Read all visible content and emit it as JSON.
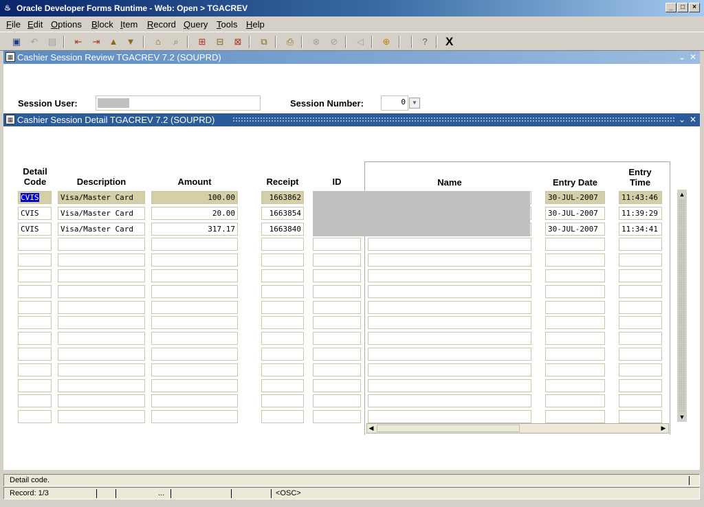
{
  "window": {
    "title": "Oracle Developer Forms Runtime - Web:  Open > TGACREV"
  },
  "menu": [
    {
      "label": "File",
      "u": "F",
      "rest": "ile"
    },
    {
      "label": "Edit",
      "u": "E",
      "rest": "dit"
    },
    {
      "label": "Options",
      "u": "O",
      "rest": "ptions"
    },
    {
      "label": "Block",
      "u": "B",
      "rest": "lock"
    },
    {
      "label": "Item",
      "u": "I",
      "rest": "tem"
    },
    {
      "label": "Record",
      "u": "R",
      "rest": "ecord"
    },
    {
      "label": "Query",
      "u": "Q",
      "rest": "uery"
    },
    {
      "label": "Tools",
      "u": "T",
      "rest": "ools"
    },
    {
      "label": "Help",
      "u": "H",
      "rest": "elp"
    }
  ],
  "toolbar": {
    "exit_label": "X"
  },
  "review_panel": {
    "title": "Cashier Session Review  TGACREV  7.2  (SOUPRD)",
    "session_user_label": "Session User:",
    "session_user_value": "",
    "session_number_label": "Session Number:",
    "session_number_value": "0"
  },
  "detail_panel": {
    "title": "Cashier Session Detail  TGACREV  7.2  (SOUPRD)",
    "headers": {
      "detail_code_1": "Detail",
      "detail_code_2": "Code",
      "description": "Description",
      "amount": "Amount",
      "receipt": "Receipt",
      "id": "ID",
      "name": "Name",
      "entry_date": "Entry Date",
      "entry_time_1": "Entry",
      "entry_time_2": "Time"
    },
    "rows": [
      {
        "code": "CVIS",
        "description": "Visa/Master Card",
        "amount": "100.00",
        "receipt": "1663862",
        "entry_date": "30-JUL-2007",
        "entry_time": "11:43:46"
      },
      {
        "code": "CVIS",
        "description": "Visa/Master Card",
        "amount": "20.00",
        "receipt": "1663854",
        "entry_date": "30-JUL-2007",
        "entry_time": "11:39:29"
      },
      {
        "code": "CVIS",
        "description": "Visa/Master Card",
        "amount": "317.17",
        "receipt": "1663840",
        "entry_date": "30-JUL-2007",
        "entry_time": "11:34:41"
      }
    ]
  },
  "status": {
    "message": "Detail code.",
    "record": "Record: 1/3",
    "ellipsis": "...",
    "mode": "<OSC>"
  }
}
